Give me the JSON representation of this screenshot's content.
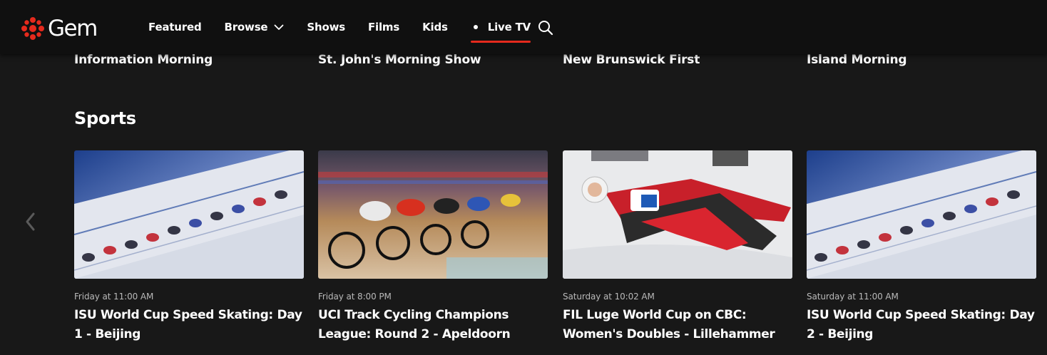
{
  "brand": {
    "name": "Gem",
    "accent_color": "#e52a1d"
  },
  "nav": {
    "items": [
      {
        "label": "Featured"
      },
      {
        "label": "Browse",
        "has_dropdown": true
      },
      {
        "label": "Shows"
      },
      {
        "label": "Films"
      },
      {
        "label": "Kids"
      },
      {
        "label": "Live TV",
        "active": true
      }
    ],
    "search_icon": "search-icon"
  },
  "previous_row": {
    "titles": [
      "Information Morning",
      "St. John's Morning Show",
      "New Brunswick First",
      "Island Morning"
    ]
  },
  "sports": {
    "title": "Sports",
    "prev_icon": "chevron-left-icon",
    "cards": [
      {
        "time": "Friday at 11:00 AM",
        "title": "ISU World Cup Speed Skating: Day 1 - Beijing",
        "image": "speed-skating"
      },
      {
        "time": "Friday at 8:00 PM",
        "title": "UCI Track Cycling Champions League: Round 2 - Apeldoorn",
        "image": "track-cycling"
      },
      {
        "time": "Saturday at 10:02 AM",
        "title": "FIL Luge World Cup on CBC: Women's Doubles - Lillehammer",
        "image": "luge"
      },
      {
        "time": "Saturday at 11:00 AM",
        "title": "ISU World Cup Speed Skating: Day 2 - Beijing",
        "image": "speed-skating"
      }
    ]
  }
}
